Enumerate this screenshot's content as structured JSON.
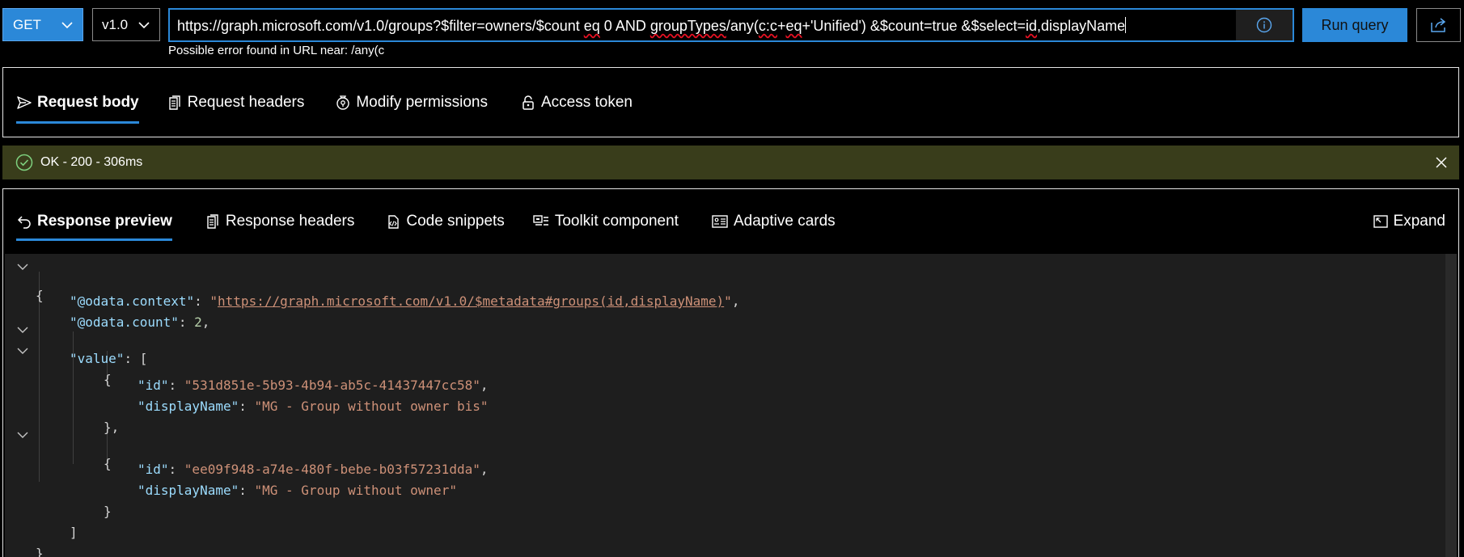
{
  "query": {
    "method": "GET",
    "version": "v1.0",
    "url_parts": {
      "p1": "https://graph.microsoft.com/v1.0/groups?$filter=owners/$count ",
      "eq1": "eq",
      "p2": " 0 AND ",
      "groupTypes": "groupTypes",
      "p3": "/any(",
      "cc": "c:c",
      "p4": "+",
      "eq2": "eq",
      "p5": "+'Unified') &$count=true &$select=",
      "id": "id",
      "p6": ",displayName"
    },
    "error": "Possible error found in URL near: /any(c",
    "run_label": "Run query"
  },
  "request_tabs": [
    {
      "label": "Request body"
    },
    {
      "label": "Request headers"
    },
    {
      "label": "Modify permissions"
    },
    {
      "label": "Access token"
    }
  ],
  "status": {
    "text": "OK - 200 - 306ms"
  },
  "response_tabs": [
    {
      "label": "Response preview"
    },
    {
      "label": "Response headers"
    },
    {
      "label": "Code snippets"
    },
    {
      "label": "Toolkit component"
    },
    {
      "label": "Adaptive cards"
    }
  ],
  "expand_label": "Expand",
  "response": {
    "context_key": "\"@odata.context\"",
    "context_value": "https://graph.microsoft.com/v1.0/$metadata#groups(id,displayName)",
    "count_key": "\"@odata.count\"",
    "count_value": "2",
    "value_key": "\"value\"",
    "id_key": "\"id\"",
    "display_key": "\"displayName\"",
    "items": [
      {
        "id": "\"531d851e-5b93-4b94-ab5c-41437447cc58\"",
        "displayName": "\"MG - Group without owner bis\""
      },
      {
        "id": "\"ee09f948-a74e-480f-bebe-b03f57231dda\"",
        "displayName": "\"MG - Group without owner\""
      }
    ]
  },
  "colors": {
    "accent": "#2b88d8",
    "status_bg": "#393d1b",
    "status_ok": "#7ed07e",
    "code_bg": "#1e1e1e",
    "json_key": "#9cdcfe",
    "json_string": "#ce9178",
    "json_number": "#b5cea8"
  }
}
